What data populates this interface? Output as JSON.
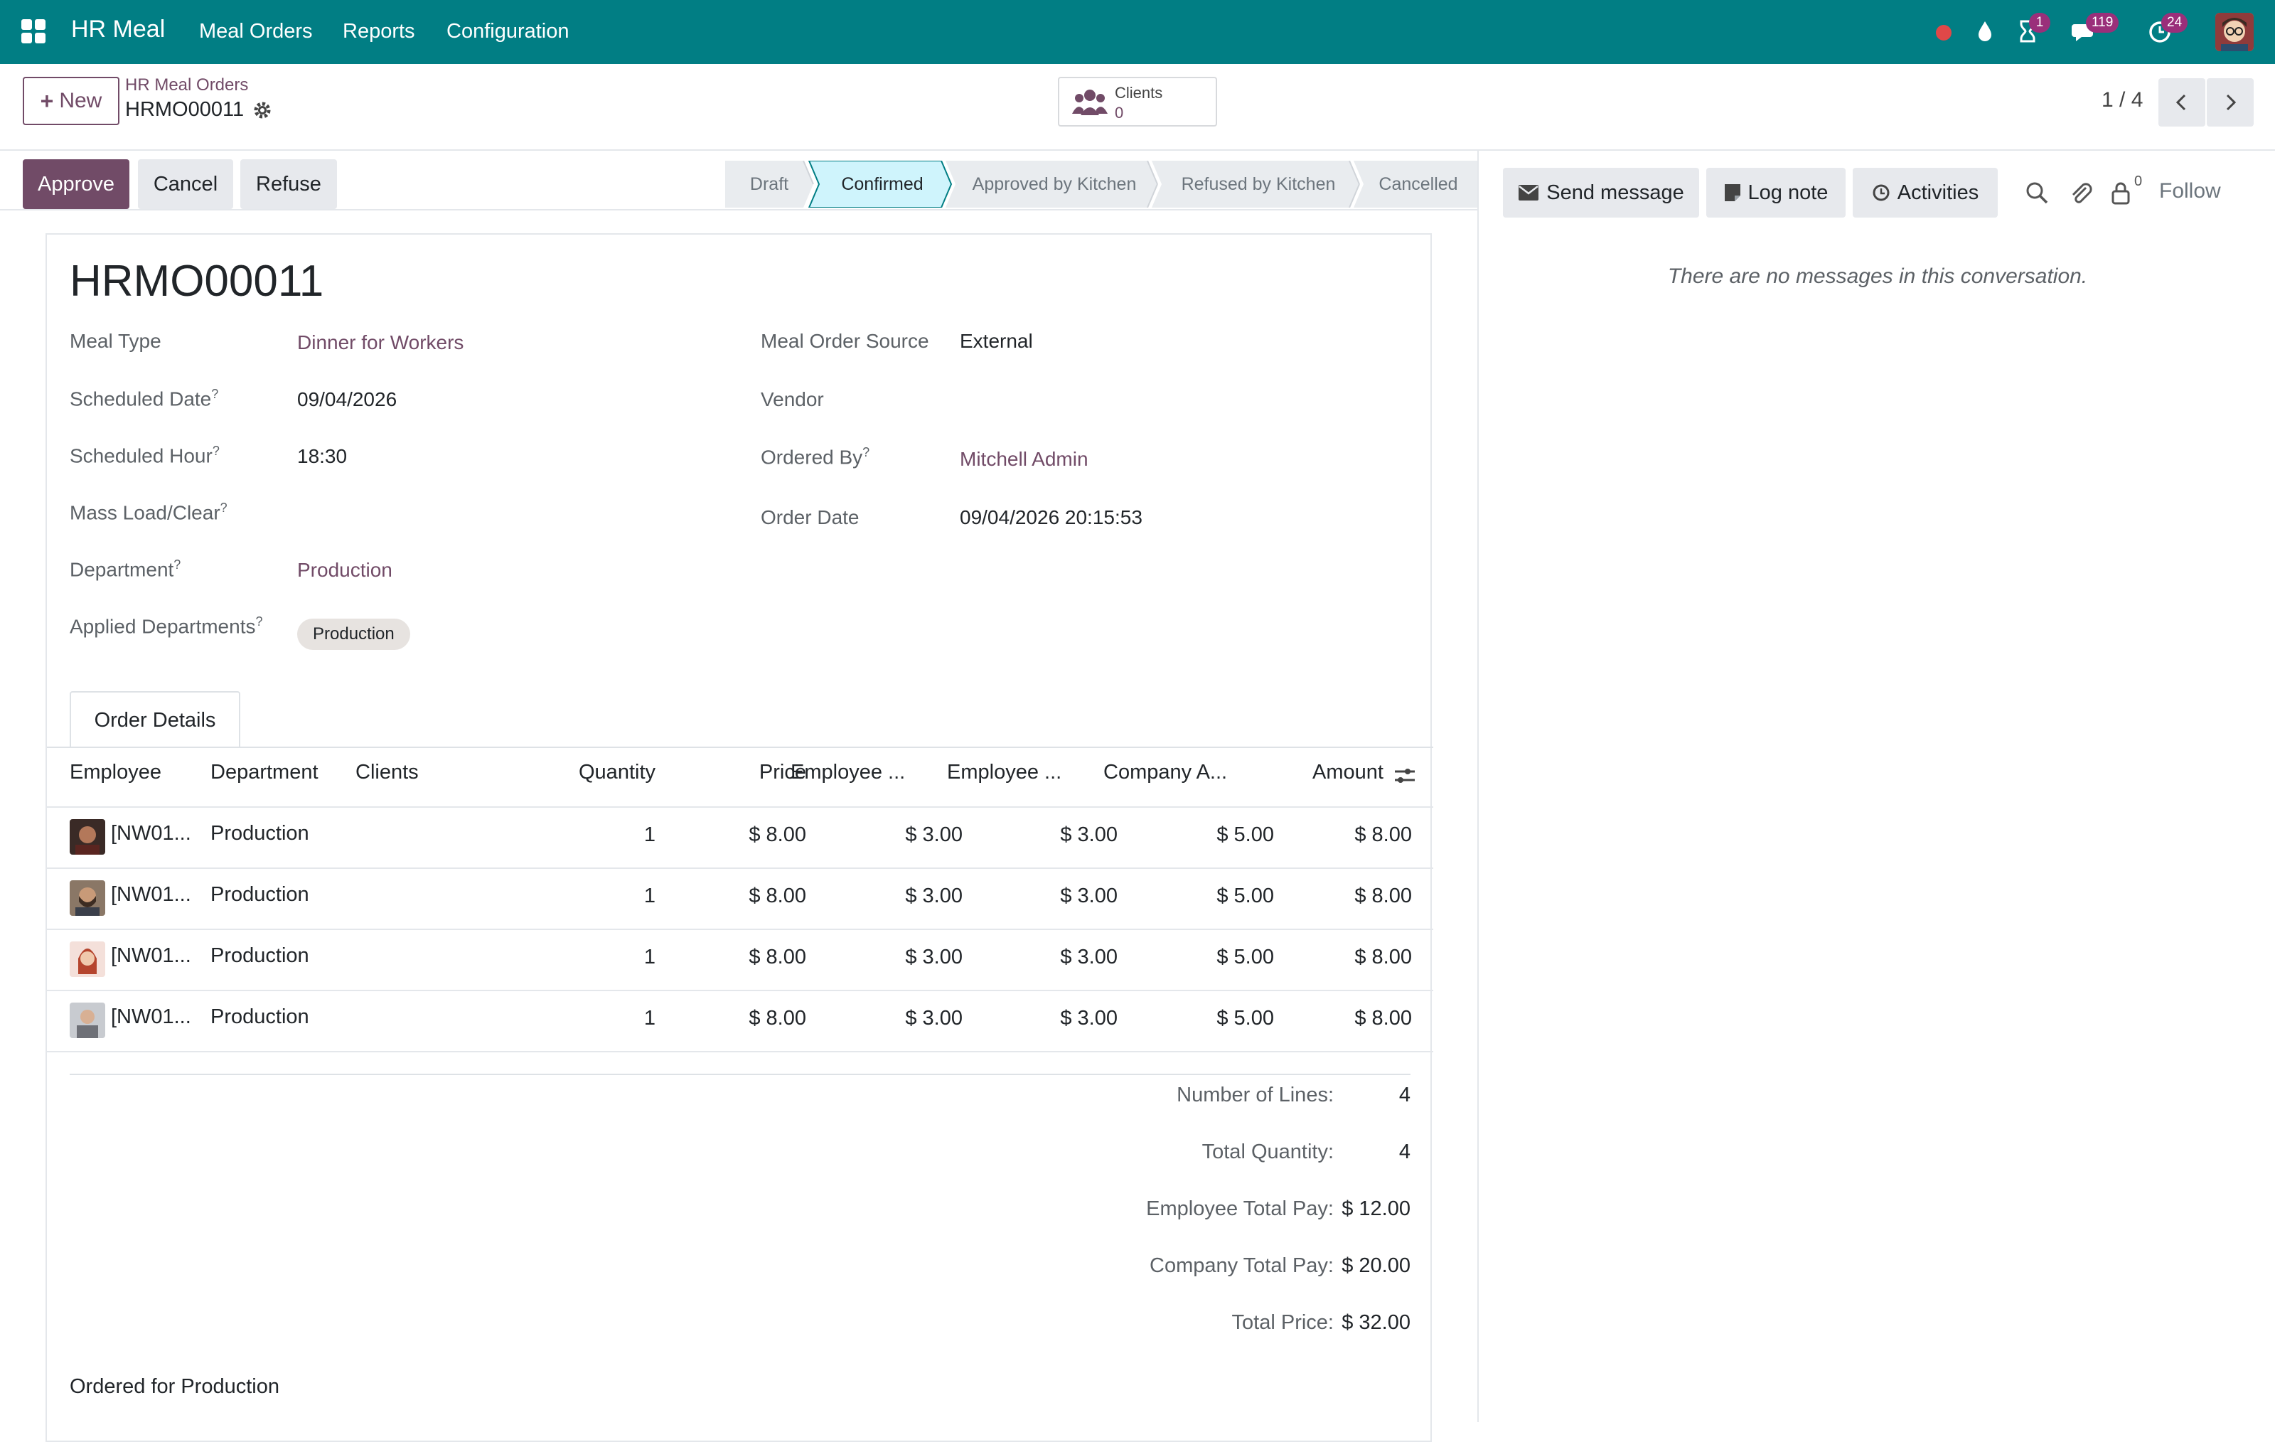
{
  "navbar": {
    "brand": "HR Meal",
    "menu": [
      "Meal Orders",
      "Reports",
      "Configuration"
    ],
    "badges": {
      "activity": "1",
      "messages": "119",
      "clock": "24"
    },
    "color": "#017e84"
  },
  "control": {
    "new_label": "New",
    "breadcrumb_parent": "HR Meal Orders",
    "breadcrumb_current": "HRMO00011",
    "smart_button": {
      "label": "Clients",
      "count": "0"
    },
    "pager": "1 / 4"
  },
  "actions": {
    "approve": "Approve",
    "cancel": "Cancel",
    "refuse": "Refuse"
  },
  "stages": {
    "items": [
      "Draft",
      "Confirmed",
      "Approved by Kitchen",
      "Refused by Kitchen",
      "Cancelled"
    ],
    "active": "Confirmed"
  },
  "record": {
    "title": "HRMO00011",
    "left": [
      {
        "label": "Meal Type",
        "help": "",
        "value": "Dinner for Workers",
        "link": true
      },
      {
        "label": "Scheduled Date",
        "help": "?",
        "value": "09/04/2026",
        "link": false
      },
      {
        "label": "Scheduled Hour",
        "help": "?",
        "value": "18:30",
        "link": false
      },
      {
        "label": "Mass Load/Clear",
        "help": "?",
        "value": "",
        "link": false
      },
      {
        "label": "Department",
        "help": "?",
        "value": "Production",
        "link": true
      },
      {
        "label": "Applied Departments",
        "help": "?",
        "value": "",
        "link": false
      }
    ],
    "applied_tag": "Production",
    "right": [
      {
        "label": "Meal Order Source",
        "help": "",
        "value": "External",
        "link": false
      },
      {
        "label": "Vendor",
        "help": "",
        "value": "",
        "link": false
      },
      {
        "label": "Ordered By",
        "help": "?",
        "value": "Mitchell Admin",
        "link": true
      },
      {
        "label": "Order Date",
        "help": "",
        "value": "09/04/2026 20:15:53",
        "link": false
      }
    ]
  },
  "tab": "Order Details",
  "table": {
    "headers": [
      "Employee",
      "Department",
      "Clients",
      "Quantity",
      "Price",
      "Employee ...",
      "Employee ...",
      "Company A...",
      "Amount"
    ],
    "rows": [
      {
        "employee": "[NW01...",
        "department": "Production",
        "clients": "",
        "quantity": "1",
        "price": "$ 8.00",
        "emp1": "$ 3.00",
        "emp2": "$ 3.00",
        "company": "$ 5.00",
        "amount": "$ 8.00"
      },
      {
        "employee": "[NW01...",
        "department": "Production",
        "clients": "",
        "quantity": "1",
        "price": "$ 8.00",
        "emp1": "$ 3.00",
        "emp2": "$ 3.00",
        "company": "$ 5.00",
        "amount": "$ 8.00"
      },
      {
        "employee": "[NW01...",
        "department": "Production",
        "clients": "",
        "quantity": "1",
        "price": "$ 8.00",
        "emp1": "$ 3.00",
        "emp2": "$ 3.00",
        "company": "$ 5.00",
        "amount": "$ 8.00"
      },
      {
        "employee": "[NW01...",
        "department": "Production",
        "clients": "",
        "quantity": "1",
        "price": "$ 8.00",
        "emp1": "$ 3.00",
        "emp2": "$ 3.00",
        "company": "$ 5.00",
        "amount": "$ 8.00"
      }
    ]
  },
  "summary": [
    {
      "label": "Number of Lines:",
      "value": "4"
    },
    {
      "label": "Total Quantity:",
      "value": "4"
    },
    {
      "label": "Employee Total Pay:",
      "value": "$ 12.00"
    },
    {
      "label": "Company Total Pay:",
      "value": "$ 20.00"
    },
    {
      "label": "Total Price:",
      "value": "$ 32.00"
    }
  ],
  "note": "Ordered for Production",
  "chatter": {
    "send_message": "Send message",
    "log_note": "Log note",
    "activities": "Activities",
    "followers_count": "0",
    "follow": "Follow",
    "empty": "There are no messages in this conversation."
  }
}
